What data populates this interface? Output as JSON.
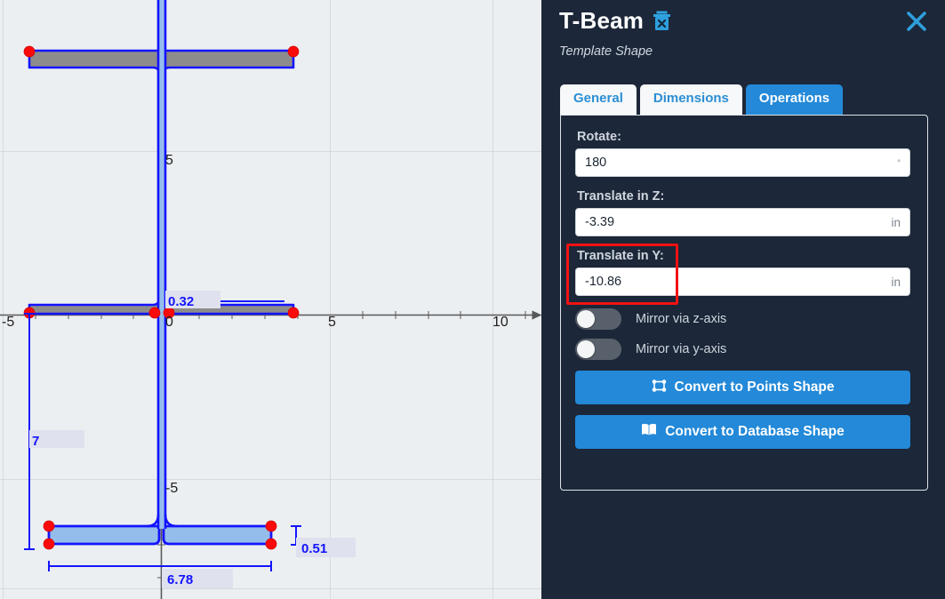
{
  "panel": {
    "title": "T-Beam",
    "subtitle": "Template Shape",
    "delete_icon": "trash-icon",
    "close_icon": "close-icon",
    "tabs": [
      {
        "label": "General",
        "active": false
      },
      {
        "label": "Dimensions",
        "active": false
      },
      {
        "label": "Operations",
        "active": true
      }
    ],
    "fields": [
      {
        "label": "Rotate:",
        "value": "180",
        "unit": "°",
        "highlighted": false
      },
      {
        "label": "Translate in Z:",
        "value": "-3.39",
        "unit": "in",
        "highlighted": false
      },
      {
        "label": "Translate in Y:",
        "value": "-10.86",
        "unit": "in",
        "highlighted": true
      }
    ],
    "toggles": [
      {
        "label": "Mirror via z-axis",
        "on": false
      },
      {
        "label": "Mirror via y-axis",
        "on": false
      }
    ],
    "buttons": [
      {
        "label": "Convert to Points Shape",
        "icon": "points-shape-icon"
      },
      {
        "label": "Convert to Database Shape",
        "icon": "database-book-icon"
      }
    ],
    "colors": {
      "panel_bg": "#1c2739",
      "accent": "#2389d8",
      "highlight": "#f21212",
      "tab_inactive_bg": "#f7f8f9"
    }
  },
  "canvas": {
    "background": "#eceff1",
    "axis_color": "#58595b",
    "grid_color": "#d6dade",
    "x_axis_labels": [
      "-5",
      "0",
      "5",
      "10"
    ],
    "y_axis_labels": [
      "5",
      "-5"
    ],
    "shapes": [
      {
        "name": "ghost-shape",
        "fill": "#8c8c8c",
        "stroke": "#1414ff",
        "state": "original-position"
      },
      {
        "name": "translated-shape",
        "fill": "#95bdeb",
        "stroke": "#1414ff",
        "state": "selected"
      }
    ],
    "dimension_labels": [
      {
        "name": "web-thickness",
        "value": "0.32"
      },
      {
        "name": "total-depth",
        "value": "7"
      },
      {
        "name": "flange-thickness",
        "value": "0.51"
      },
      {
        "name": "flange-width",
        "value": "6.78"
      }
    ]
  }
}
